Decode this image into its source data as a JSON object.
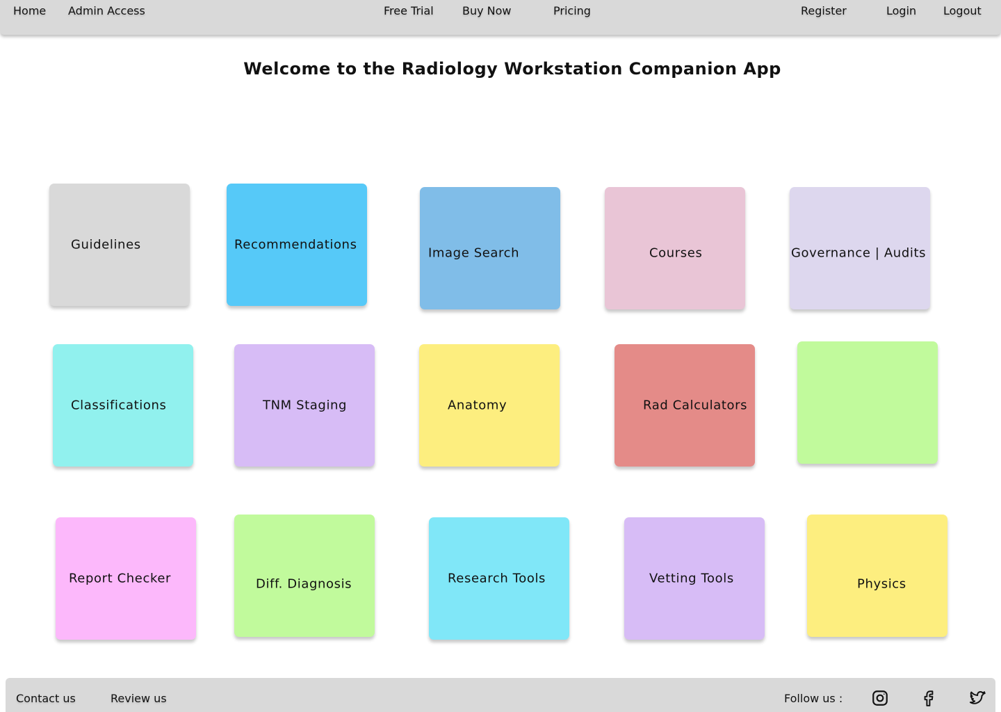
{
  "nav": {
    "home": "Home",
    "admin": "Admin Access",
    "free_trial": "Free Trial",
    "buy_now": "Buy Now",
    "pricing": "Pricing",
    "register": "Register",
    "login": "Login",
    "logout": "Logout"
  },
  "title": "Welcome to the Radiology Workstation Companion App",
  "tiles": [
    {
      "label": "Guidelines",
      "color": "#d9d9d9"
    },
    {
      "label": "Recommendations",
      "color": "#56c9f8"
    },
    {
      "label": "Image Search",
      "color": "#80bde8"
    },
    {
      "label": "Courses",
      "color": "#e9c5d6"
    },
    {
      "label": "Governance | Audits",
      "color": "#ddd7ee"
    },
    {
      "label": "Classifications",
      "color": "#91f1ee"
    },
    {
      "label": "TNM Staging",
      "color": "#d7bcf6"
    },
    {
      "label": "Anatomy",
      "color": "#fdee7f"
    },
    {
      "label": "Rad Calculators",
      "color": "#e48b88"
    },
    {
      "label": "",
      "color": "#c1fa9c"
    },
    {
      "label": "Report Checker",
      "color": "#fcb8fb"
    },
    {
      "label": "Diff. Diagnosis",
      "color": "#c1fa9c"
    },
    {
      "label": "Research Tools",
      "color": "#80e7f8"
    },
    {
      "label": "Vetting Tools",
      "color": "#d7bcf6"
    },
    {
      "label": "Physics",
      "color": "#fdee7f"
    }
  ],
  "footer": {
    "contact": "Contact us",
    "review": "Review us",
    "follow": "Follow us :",
    "socials": [
      "instagram-icon",
      "facebook-icon",
      "twitter-icon"
    ]
  }
}
